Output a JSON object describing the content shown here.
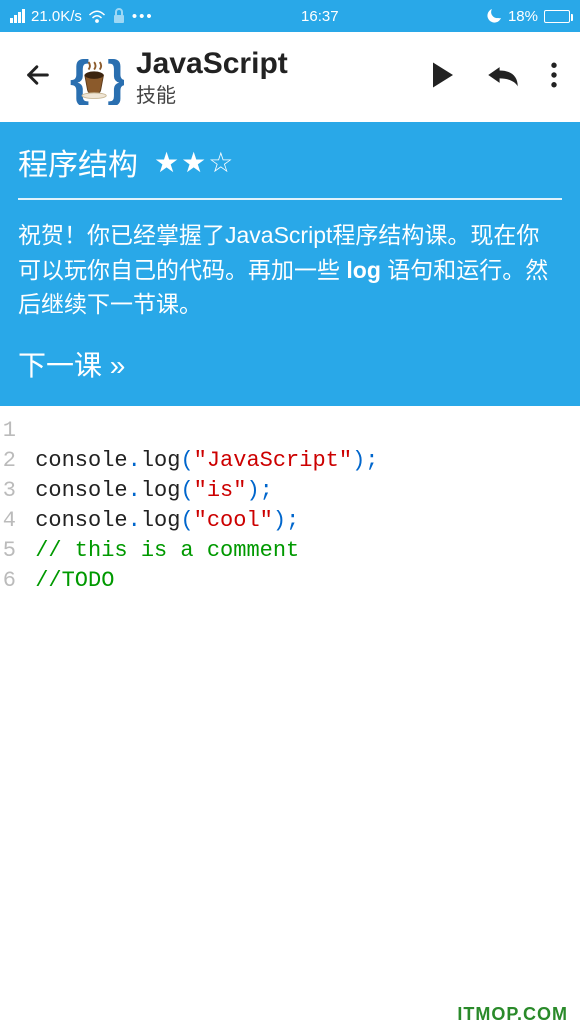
{
  "status": {
    "speed": "21.0K/s",
    "time": "16:37",
    "battery": "18%"
  },
  "header": {
    "title": "JavaScript",
    "subtitle": "技能"
  },
  "lesson": {
    "title": "程序结构",
    "stars": "★★☆",
    "desc_prefix": "祝贺！你已经掌握了JavaScript程序结构课。现在你可以玩你自己的代码。再加一些 ",
    "desc_bold": "log",
    "desc_suffix": " 语句和运行。然后继续下一节课。",
    "next": "下一课 »"
  },
  "code": {
    "lines": [
      {
        "n": "1",
        "tokens": []
      },
      {
        "n": "2",
        "tokens": [
          {
            "t": "ident",
            "v": "console"
          },
          {
            "t": "dot",
            "v": "."
          },
          {
            "t": "method",
            "v": "log"
          },
          {
            "t": "paren",
            "v": "("
          },
          {
            "t": "string",
            "v": "\"JavaScript\""
          },
          {
            "t": "paren",
            "v": ")"
          },
          {
            "t": "semi",
            "v": ";"
          }
        ]
      },
      {
        "n": "3",
        "tokens": [
          {
            "t": "ident",
            "v": "console"
          },
          {
            "t": "dot",
            "v": "."
          },
          {
            "t": "method",
            "v": "log"
          },
          {
            "t": "paren",
            "v": "("
          },
          {
            "t": "string",
            "v": "\"is\""
          },
          {
            "t": "paren",
            "v": ")"
          },
          {
            "t": "semi",
            "v": ";"
          }
        ]
      },
      {
        "n": "4",
        "tokens": [
          {
            "t": "ident",
            "v": "console"
          },
          {
            "t": "dot",
            "v": "."
          },
          {
            "t": "method",
            "v": "log"
          },
          {
            "t": "paren",
            "v": "("
          },
          {
            "t": "string",
            "v": "\"cool\""
          },
          {
            "t": "paren",
            "v": ")"
          },
          {
            "t": "semi",
            "v": ";"
          }
        ]
      },
      {
        "n": "5",
        "tokens": [
          {
            "t": "comment",
            "v": "// this is a comment"
          }
        ]
      },
      {
        "n": "6",
        "tokens": [
          {
            "t": "comment",
            "v": "//TODO"
          }
        ]
      }
    ]
  },
  "watermark": "ITMOP.COM"
}
